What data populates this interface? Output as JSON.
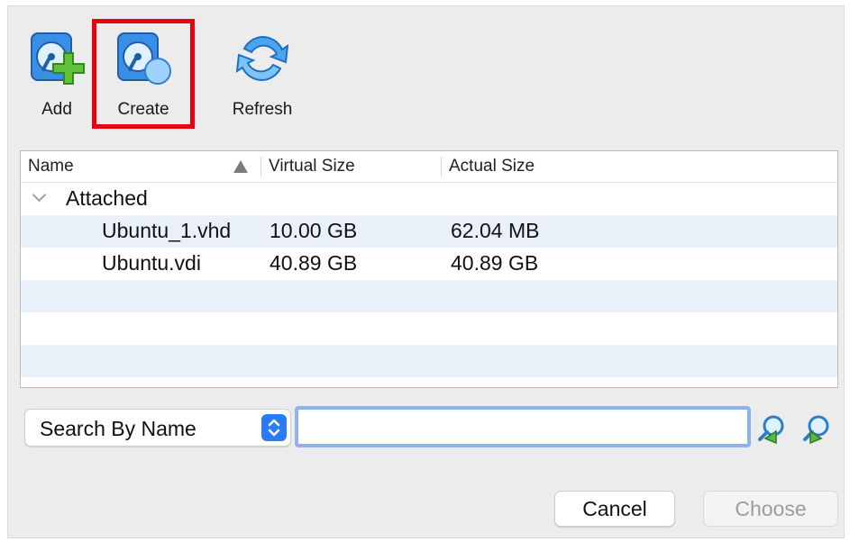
{
  "toolbar": {
    "add_label": "Add",
    "create_label": "Create",
    "refresh_label": "Refresh",
    "highlight_color": "#e8000e"
  },
  "table": {
    "columns": {
      "name": "Name",
      "virtual_size": "Virtual Size",
      "actual_size": "Actual Size"
    },
    "group_label": "Attached",
    "rows": [
      {
        "name": "Ubuntu_1.vhd",
        "virtual_size": "10.00 GB",
        "actual_size": "62.04 MB"
      },
      {
        "name": "Ubuntu.vdi",
        "virtual_size": "40.89 GB",
        "actual_size": "40.89 GB"
      }
    ]
  },
  "search": {
    "mode": "Search By Name",
    "value": "",
    "accent": "#2c7bf6"
  },
  "buttons": {
    "cancel": "Cancel",
    "choose": "Choose"
  }
}
